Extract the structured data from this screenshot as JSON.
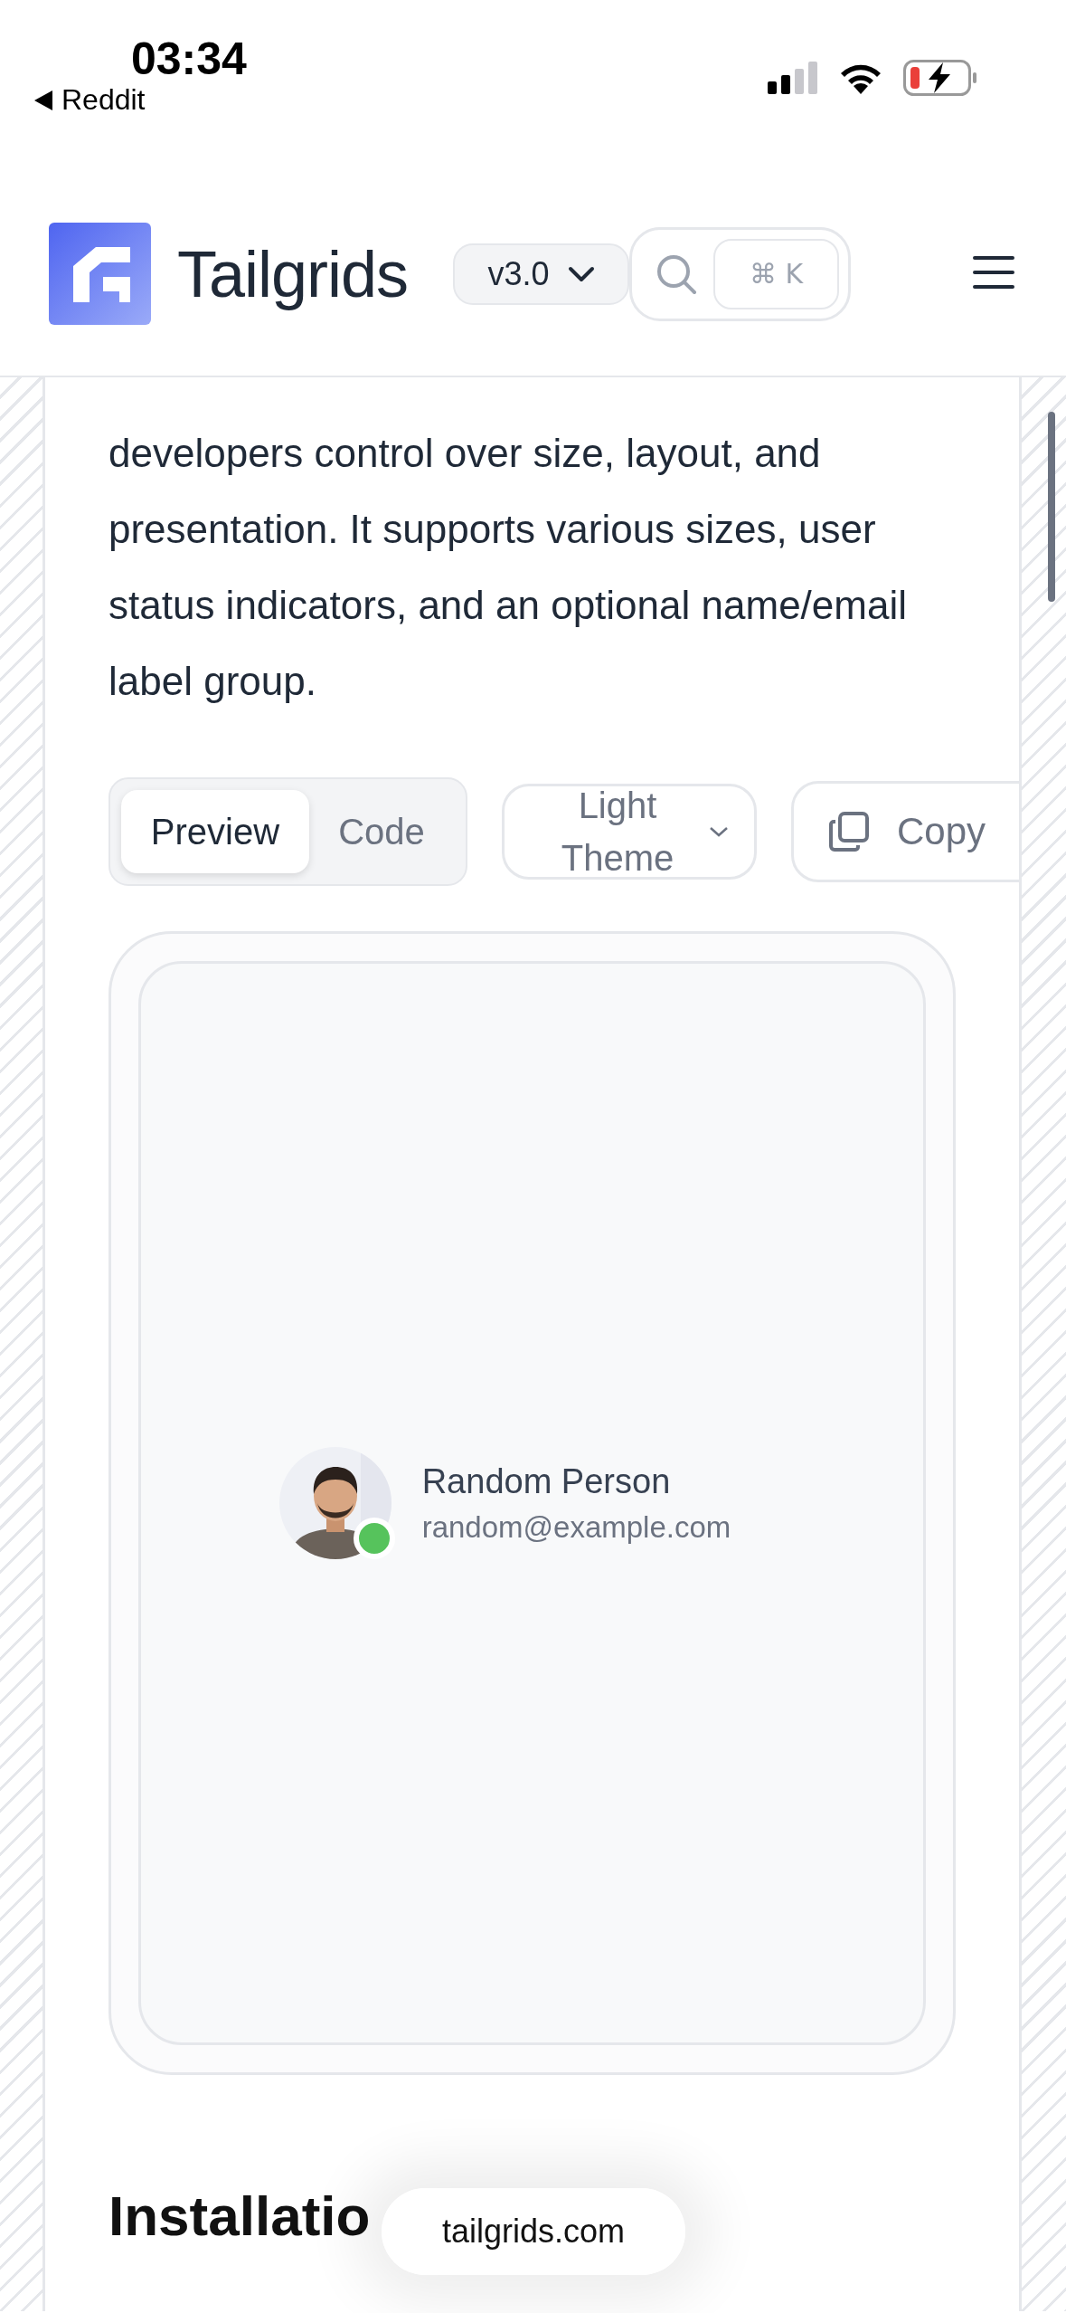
{
  "status_bar": {
    "time": "03:34",
    "back_label": "Reddit"
  },
  "header": {
    "logo_text": "Tailgrids",
    "version": "v3.0",
    "search_shortcut": "⌘ K"
  },
  "description": "developers control over size, layout, and presentation. It supports various sizes, user status indicators, and an optional name/email label group.",
  "tabs": [
    {
      "label": "Preview",
      "selected": true
    },
    {
      "label": "Code",
      "selected": false
    }
  ],
  "theme_select": {
    "value": "Light Theme"
  },
  "copy_button": {
    "label": "Copy"
  },
  "preview": {
    "user": {
      "name": "Random Person",
      "email": "random@example.com",
      "online": true
    }
  },
  "heading": "Installatio",
  "url_pill": "tailgrids.com"
}
